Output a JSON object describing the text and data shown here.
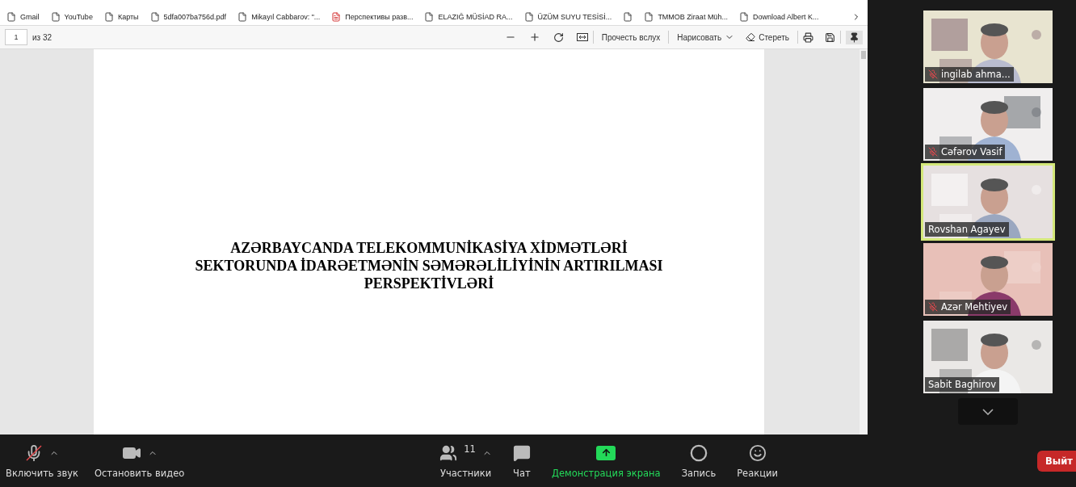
{
  "bookmarks": [
    {
      "label": "Gmail",
      "kind": "page"
    },
    {
      "label": "YouTube",
      "kind": "page"
    },
    {
      "label": "Карты",
      "kind": "page"
    },
    {
      "label": "5dfa007ba756d.pdf",
      "kind": "page"
    },
    {
      "label": "Mikayıl Cabbarov: \"...",
      "kind": "page"
    },
    {
      "label": "Перспективы разв...",
      "kind": "pdf"
    },
    {
      "label": "ELAZIĞ MÜSİAD RA...",
      "kind": "page"
    },
    {
      "label": "ÜZÜM SUYU TESİSİ...",
      "kind": "page"
    },
    {
      "kind": "page"
    },
    {
      "label": "TMMOB Ziraat Müh...",
      "kind": "page"
    },
    {
      "label": "Download Albert K...",
      "kind": "page"
    }
  ],
  "pdf_toolbar": {
    "page_number": "1",
    "page_total": "из 32",
    "read_aloud": "Прочесть вслух",
    "draw": "Нарисовать",
    "erase": "Стереть",
    "pinned": true
  },
  "document": {
    "title_lines": [
      "AZƏRBAYCANDA TELEKOMMUNİKASİYA XİDMƏTLƏRİ",
      "SEKTORUNDA İDARƏETMƏNİN SƏMƏRƏLİLİYİNİN ARTIRILMASI",
      "PERSPEKTİVLƏRİ"
    ]
  },
  "participants": [
    {
      "name": "ingilab ahma...",
      "muted": true,
      "selected": false
    },
    {
      "name": "Cəfərov Vasif",
      "muted": true,
      "selected": false
    },
    {
      "name": "Rovshan Agayev",
      "muted": false,
      "selected": true
    },
    {
      "name": "Azər Mehtiyev",
      "muted": true,
      "selected": false
    },
    {
      "name": "Sabit Baghirov",
      "muted": false,
      "selected": false
    }
  ],
  "toolbar": {
    "left": [
      {
        "kind": "mic",
        "label": "Включить звук",
        "muted": true
      },
      {
        "kind": "video",
        "label": "Остановить видео"
      }
    ],
    "center": [
      {
        "kind": "participants",
        "label": "Участники",
        "count": "11"
      },
      {
        "kind": "chat",
        "label": "Чат"
      },
      {
        "kind": "share",
        "label": "Демонстрация экрана"
      },
      {
        "kind": "record",
        "label": "Запись"
      },
      {
        "kind": "reactions",
        "label": "Реакции"
      }
    ],
    "leave": "Выйт"
  }
}
